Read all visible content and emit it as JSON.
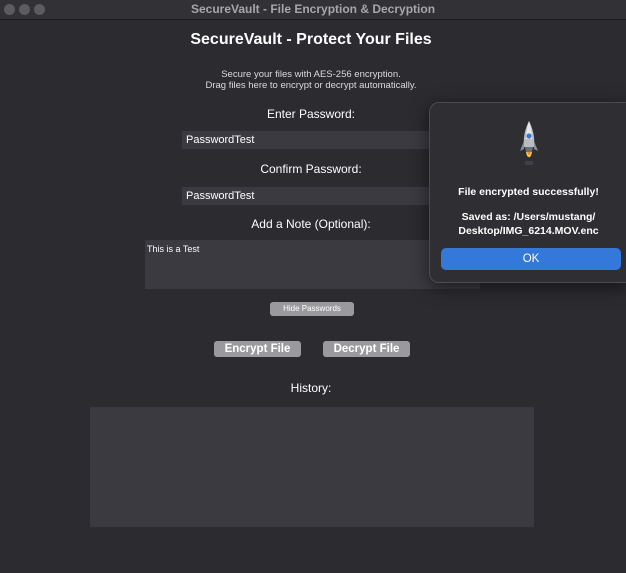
{
  "window": {
    "title": "SecureVault - File Encryption & Decryption"
  },
  "main": {
    "heading": "SecureVault - Protect Your Files",
    "description_line1": "Secure your files with AES-256 encryption.",
    "description_line2": "Drag files here to encrypt or decrypt automatically.",
    "password_label": "Enter Password:",
    "password_value": "PasswordTest",
    "confirm_label": "Confirm Password:",
    "confirm_value": "PasswordTest",
    "note_label": "Add a Note (Optional):",
    "note_value": "This is a Test",
    "hide_passwords_label": "Hide Passwords",
    "encrypt_label": "Encrypt File",
    "decrypt_label": "Decrypt File",
    "history_label": "History:",
    "history_items": []
  },
  "dialog": {
    "icon": "rocket-icon",
    "message": "File encrypted successfully!",
    "saved_line1": "Saved as: /Users/mustang/",
    "saved_line2": "Desktop/IMG_6214.MOV.enc",
    "ok_label": "OK"
  },
  "colors": {
    "background": "#2b2b30",
    "field": "#3a3a40",
    "button": "#9a9a9e",
    "accent": "#3478d9"
  }
}
